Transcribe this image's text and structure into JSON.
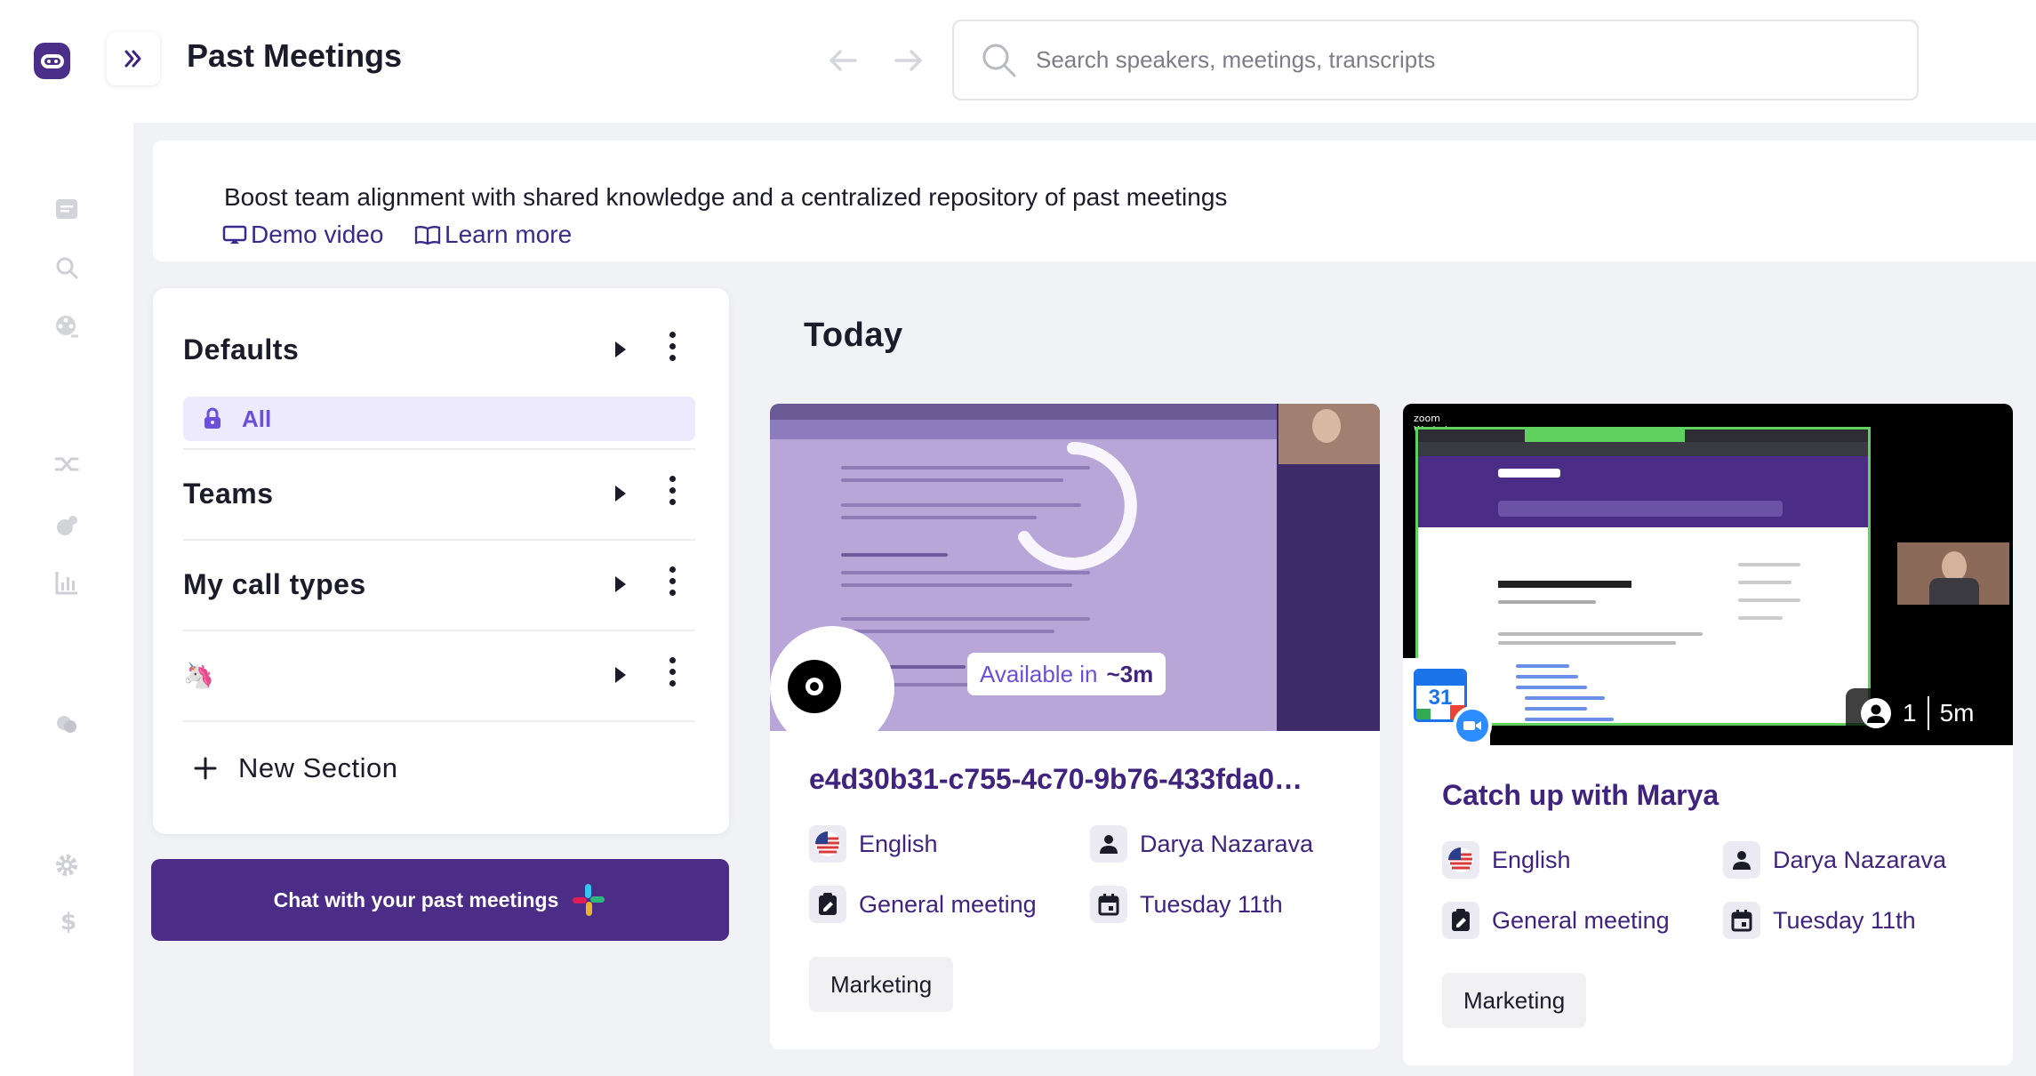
{
  "header": {
    "title": "Past Meetings",
    "search_placeholder": "Search speakers, meetings, transcripts"
  },
  "banner": {
    "text": "Boost team alignment with shared knowledge and a centralized repository of past meetings",
    "demo_link": "Demo video",
    "learn_link": "Learn more"
  },
  "sidebar": {
    "sections": [
      {
        "label": "Defaults"
      },
      {
        "label": "Teams"
      },
      {
        "label": "My call types"
      },
      {
        "label": "🦄"
      }
    ],
    "all_label": "All",
    "new_section": "New Section",
    "chat_button": "Chat with your past meetings"
  },
  "content": {
    "group_label": "Today",
    "meetings": [
      {
        "title": "e4d30b31-c755-4c70-9b76-433fda0…",
        "status": "Available in",
        "eta": "~3m",
        "language": "English",
        "host": "Darya Nazarava",
        "type": "General meeting",
        "date": "Tuesday 11th",
        "tag": "Marketing"
      },
      {
        "title": "Catch up with Marya",
        "participants": "1",
        "duration": "5m",
        "calendar_day": "31",
        "language": "English",
        "host": "Darya Nazarava",
        "type": "General meeting",
        "date": "Tuesday 11th",
        "tag": "Marketing"
      }
    ]
  },
  "colors": {
    "brand": "#4b2c86",
    "accent": "#6b4fd8",
    "link": "#3f237f",
    "background": "#f1f2f5"
  }
}
